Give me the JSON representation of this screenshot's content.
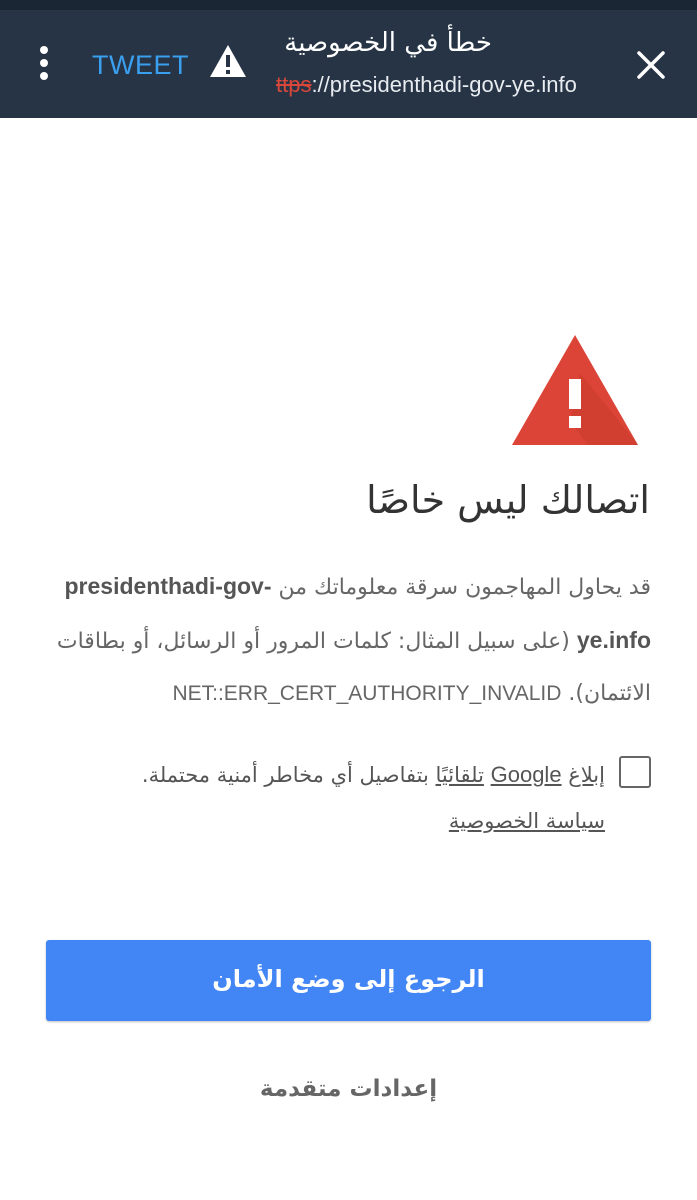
{
  "toolbar": {
    "tweet_label": "TWEET",
    "title": "خطأ في الخصوصية",
    "url_scheme": "ttps",
    "url_rest": "://presidenthadi-gov-ye.info"
  },
  "page": {
    "heading": "اتصالك ليس خاصًا",
    "desc_start": "قد يحاول المهاجمون سرقة معلوماتك من",
    "desc_domain": "presidenthadi-gov-ye.info",
    "desc_middle": "(على سبيل المثال: كلمات المرور أو الرسائل، أو بطاقات الائتمان).",
    "desc_error": "NET::ERR_CERT_AUTHORITY_INVALID",
    "report_prefix": "إبلاغ",
    "report_google": "Google",
    "report_auto": "تلقائيًا",
    "report_rest": "بتفاصيل أي مخاطر أمنية محتملة.",
    "privacy_link": "سياسة الخصوصية",
    "back_button": "الرجوع إلى وضع الأمان",
    "advanced": "إعدادات متقدمة"
  },
  "colors": {
    "toolbar_bg": "#263445",
    "tweet": "#3b9ff0",
    "warning_red": "#db4437",
    "button_blue": "#4285f4"
  },
  "icons": [
    "overflow-menu-icon",
    "warning-icon",
    "close-icon",
    "warning-large-icon"
  ]
}
